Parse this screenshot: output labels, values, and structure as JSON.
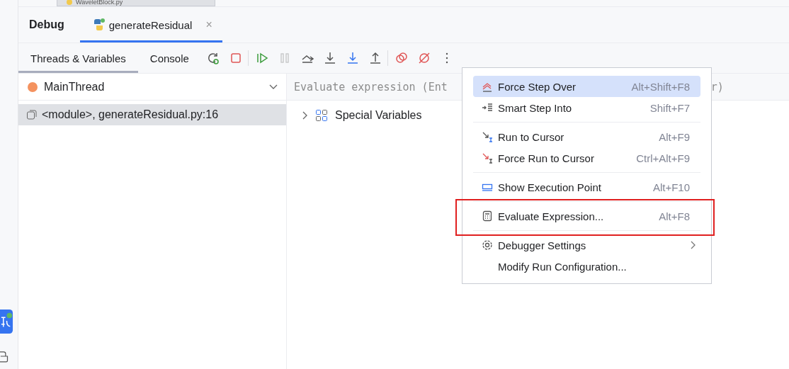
{
  "editor_tab": {
    "label": "WaveletBlock.py"
  },
  "debug_header": {
    "title": "Debug",
    "tabs": [
      {
        "label": "generateResidual",
        "selected": true,
        "close": "×"
      }
    ]
  },
  "subtabs": [
    {
      "label": "Threads & Variables",
      "selected": true
    },
    {
      "label": "Console",
      "selected": false
    }
  ],
  "toolbar": [
    [
      {
        "kind": "rerun",
        "disabled": false
      },
      {
        "kind": "stop",
        "disabled": false
      }
    ],
    [
      {
        "kind": "resume",
        "disabled": false
      },
      {
        "kind": "pause",
        "disabled": true
      },
      {
        "kind": "step-over",
        "disabled": false
      },
      {
        "kind": "step-into",
        "disabled": false
      },
      {
        "kind": "step-into-mine",
        "disabled": false
      },
      {
        "kind": "step-out",
        "disabled": false
      }
    ],
    [
      {
        "kind": "breakpoints",
        "disabled": false
      },
      {
        "kind": "mute",
        "disabled": false
      },
      {
        "kind": "more",
        "disabled": false
      }
    ]
  ],
  "thread": {
    "name": "MainThread"
  },
  "frames": [
    {
      "label": "<module>, generateResidual.py:16",
      "selected": true
    }
  ],
  "evaluate_field": {
    "placeholder": "Evaluate expression (Ent",
    "placeholder_end": "r)"
  },
  "variables": [
    {
      "label": "Special Variables",
      "expanded": false
    }
  ],
  "menu": {
    "sections": [
      [
        {
          "kind": "force-step-over",
          "label": "Force Step Over",
          "shortcut": "Alt+Shift+F8",
          "selected": true,
          "highlighted": false,
          "submenu": false
        },
        {
          "kind": "smart-step",
          "label": "Smart Step Into",
          "shortcut": "Shift+F7",
          "selected": false,
          "highlighted": false,
          "submenu": false
        }
      ],
      [
        {
          "kind": "run-cursor",
          "label": "Run to Cursor",
          "shortcut": "Alt+F9",
          "selected": false,
          "highlighted": false,
          "submenu": false
        },
        {
          "kind": "force-run-cursor",
          "label": "Force Run to Cursor",
          "shortcut": "Ctrl+Alt+F9",
          "selected": false,
          "highlighted": false,
          "submenu": false
        }
      ],
      [
        {
          "kind": "exec-point",
          "label": "Show Execution Point",
          "shortcut": "Alt+F10",
          "selected": false,
          "highlighted": false,
          "submenu": false
        }
      ],
      [
        {
          "kind": "calculator",
          "label": "Evaluate Expression...",
          "shortcut": "Alt+F8",
          "selected": false,
          "highlighted": true,
          "submenu": false
        }
      ],
      [
        {
          "kind": "gear",
          "label": "Debugger Settings",
          "selected": false,
          "highlighted": false,
          "submenu": true
        },
        {
          "kind": "none",
          "label": "Modify Run Configuration...",
          "selected": false,
          "highlighted": false,
          "submenu": false
        }
      ]
    ]
  }
}
